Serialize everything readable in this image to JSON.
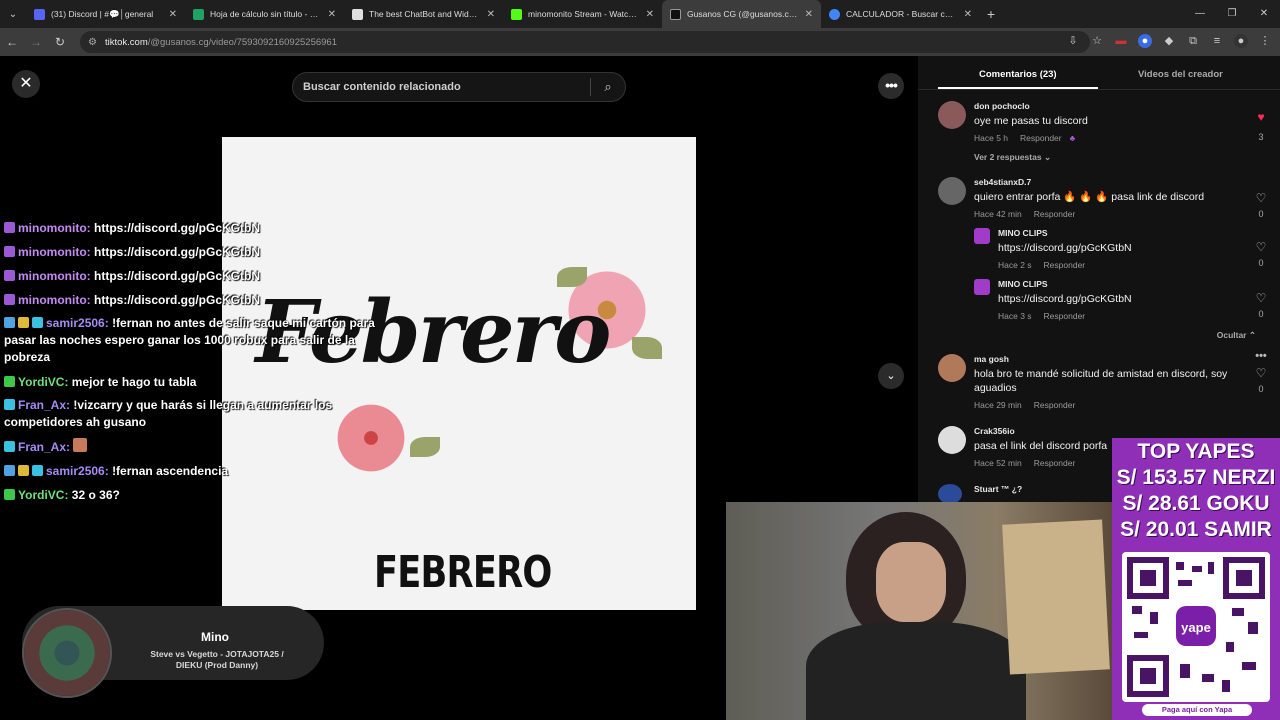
{
  "browser": {
    "tabs": [
      {
        "title": "(31) Discord | #💬│general",
        "color": "#5865f2",
        "active": false
      },
      {
        "title": "Hoja de cálculo sin título - Hoja",
        "color": "#1ea362",
        "active": false
      },
      {
        "title": "The best ChatBot and Widgets",
        "color": "#e0e0e0",
        "active": false
      },
      {
        "title": "minomonito Stream - Watch Live",
        "color": "#53fc18",
        "active": false
      },
      {
        "title": "Gusanos CG (@gusanos.cg) | TikTok",
        "color": "#111111",
        "active": true
      },
      {
        "title": "CALCULADOR - Buscar con Google",
        "color": "#4285f4",
        "active": false
      }
    ],
    "url_host": "tiktok.com",
    "url_path": "/@gusanos.cg/video/7593092160925256961"
  },
  "search": {
    "placeholder": "Buscar contenido relacionado"
  },
  "video": {
    "script_text": "Febrero",
    "caption": "FEBRERO"
  },
  "chat": [
    {
      "user": "minomonito",
      "msg": "https://discord.gg/pGcKGtbN",
      "color": "purple"
    },
    {
      "user": "minomonito",
      "msg": "https://discord.gg/pGcKGtbN",
      "color": "purple"
    },
    {
      "user": "minomonito",
      "msg": "https://discord.gg/pGcKGtbN",
      "color": "purple"
    },
    {
      "user": "minomonito",
      "msg": "https://discord.gg/pGcKGtbN",
      "color": "purple"
    },
    {
      "user": "samir2506",
      "msg": "!fernan no antes de salir saque mi cartón para pasar las noches espero ganar los 1000 robux para salir de la pobreza",
      "color": "blue"
    },
    {
      "user": "YordiVC",
      "msg": "mejor te hago tu tabla",
      "color": "green"
    },
    {
      "user": "Fran_Ax",
      "msg": "!vizcarry y que harás si llegan a aumentar los competidores ah gusano",
      "color": "blue"
    },
    {
      "user": "Fran_Ax",
      "msg": "",
      "color": "blue"
    },
    {
      "user": "samir2506",
      "msg": "!fernan ascendencia",
      "color": "blue"
    },
    {
      "user": "YordiVC",
      "msg": "32 o 36?",
      "color": "green"
    }
  ],
  "music": {
    "title": "Mino",
    "song": "Steve vs Vegetto - JOTAJOTA25 / DIEKU (Prod Danny)"
  },
  "panel": {
    "tab_comments": "Comentarios (23)",
    "tab_creator": "Videos del creador",
    "reply_label": "Responder",
    "view_replies": "Ver 2 respuestas",
    "hide_label": "Ocultar",
    "comments": [
      {
        "name": "don pochoclo",
        "text": "oye me pasas tu discord",
        "time": "Hace 5 h",
        "likes": "3"
      },
      {
        "name": "seb4stianxD.7",
        "text": "quiero entrar porfa 🔥 🔥 🔥 pasa link de discord",
        "time": "Hace 42 min",
        "likes": "0"
      },
      {
        "name": "MINO CLIPS",
        "text": "https://discord.gg/pGcKGtbN",
        "time": "Hace 2 s",
        "likes": "0"
      },
      {
        "name": "MINO CLIPS",
        "text": "https://discord.gg/pGcKGtbN",
        "time": "Hace 3 s",
        "likes": "0"
      },
      {
        "name": "ma gosh",
        "text": "hola bro te mandé solicitud de amistad en discord, soy aguadios",
        "time": "Hace 29 min",
        "likes": "0"
      },
      {
        "name": "Crak356io",
        "text": "pasa el link del discord porfa",
        "time": "Hace 52 min",
        "likes": ""
      },
      {
        "name": "Stuart ™ ¿?",
        "text": "",
        "time": "",
        "likes": ""
      }
    ]
  },
  "yapes": {
    "title": "TOP YAPES",
    "lines": [
      "S/ 153.57 NERZI",
      "S/ 28.61 GOKU",
      "S/ 20.01 SAMIR"
    ],
    "footer": "Paga aquí con Yapa"
  },
  "colors": {
    "accent_like": "#fe2c55",
    "panel_bg": "#121212",
    "yape_purple": "#8f2fb8"
  }
}
